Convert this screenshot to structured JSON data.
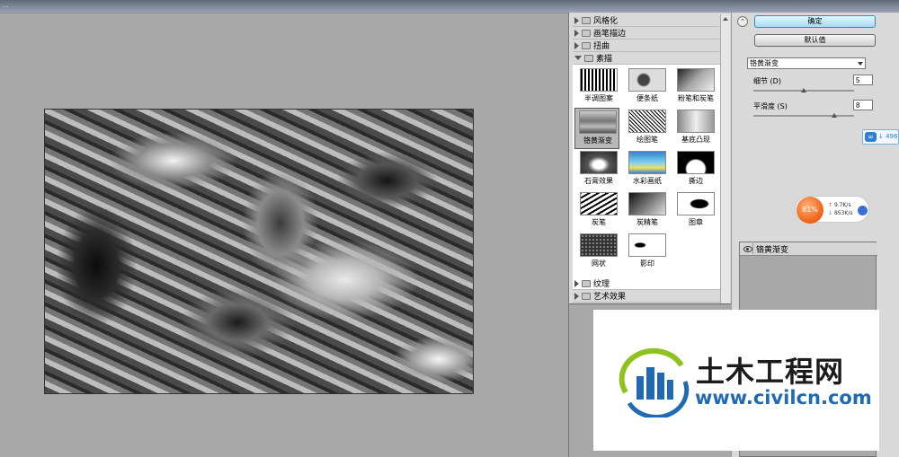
{
  "window": {
    "title": "…"
  },
  "filter_gallery": {
    "categories_top": [
      {
        "label": "风格化"
      },
      {
        "label": "画笔描边"
      },
      {
        "label": "扭曲"
      },
      {
        "label": "素描"
      }
    ],
    "categories_bottom": [
      {
        "label": "纹理"
      },
      {
        "label": "艺术效果"
      }
    ],
    "thumbnails": [
      {
        "label": "半调图案"
      },
      {
        "label": "便条纸"
      },
      {
        "label": "粉笔和炭笔"
      },
      {
        "label": "铬黄渐变"
      },
      {
        "label": "绘图笔"
      },
      {
        "label": "基底凸现"
      },
      {
        "label": "石膏效果"
      },
      {
        "label": "水彩画纸"
      },
      {
        "label": "撕边"
      },
      {
        "label": "炭笔"
      },
      {
        "label": "炭精笔"
      },
      {
        "label": "图章"
      },
      {
        "label": "网状"
      },
      {
        "label": "影印"
      }
    ],
    "selected_thumbnail": "铬黄渐变"
  },
  "settings": {
    "ok_label": "确定",
    "default_label": "默认值",
    "filter_select_value": "铬黄渐变",
    "detail_label": "细节 (D)",
    "detail_value": "5",
    "detail_level": 0.5,
    "smoothness_label": "平滑度 (S)",
    "smoothness_value": "8",
    "smoothness_level": 0.8,
    "layer_name": "铬黄渐变"
  },
  "widgets": {
    "net_text": "496",
    "cpu_percent": "81%",
    "upload_speed": "9.7K/s",
    "download_speed": "853K/s"
  },
  "watermark": {
    "name": "土木工程网",
    "url": "www.civilcn.com"
  }
}
